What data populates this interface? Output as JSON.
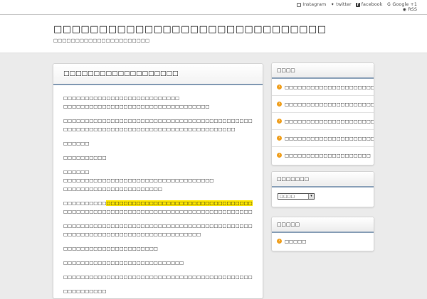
{
  "sns": {
    "instagram": "Instagram",
    "twitter": "twitter",
    "facebook": "facebook",
    "google": "Google +1",
    "rss": "RSS"
  },
  "header": {
    "title": "□□□□□□□□□□□□□□□□□□□□□□□□□□□□□□",
    "description": "□□□□□□□□□□□□□□□□□□□□□□"
  },
  "post": {
    "title": "□□□□□□□□□□□□□□□□□□□",
    "paragraphs": [
      [
        "□□□□□□□□□□□□□□□□□□□□□□□□□□□",
        "□□□□□□□□□□□□□□□□□□□□□□□□□□□□□□□□□□"
      ],
      [
        "□□□□□□□□□□□□□□□□□□□□□□□□□□□□□□□□□□□□□□□□□□□□□□□□□□□□□□□□□□□□□",
        "□□□□□□□□□□□□□□□□□□□□□□□□□□□□□□□□□□□□□□□□"
      ],
      [
        "□□□□□□"
      ],
      [
        "□□□□□□□□□□"
      ],
      [
        "□□□□□□",
        "□□□□□□□□□□□□□□□□□□□□□□□□□□□□□□□□□□□",
        "□□□□□□□□□□□□□□□□□□□□□□□"
      ]
    ],
    "highlight_line": {
      "pre": "□□□□□□□□□□",
      "mark": "□□□□□□□□□□□□□□□□□□□□□□□□□□□□□□□□□□□□□□□",
      "post": "□□□□□"
    },
    "highlight_line2": "□□□□□□□□□□□□□□□□□□□□□□□□□□□□□□□□□□□□□□□□□□□□□□□□□□□",
    "paragraphs_after": [
      [
        "□□□□□□□□□□□□□□□□□□□□□□□□□□□□□□□□□□□□□□□□□□□□□□□□□□□□□□□□□□□□□",
        "□□□□□□□□□□□□□□□□□□□□□□□□□□□□□□□□"
      ],
      [
        "□□□□□□□□□□□□□□□□□□□□□□"
      ],
      [
        "□□□□□□□□□□□□□□□□□□□□□□□□□□□□"
      ],
      [
        "□□□□□□□□□□□□□□□□□□□□□□□□□□□□□□□□□□□□□□□□□□□□□□□□□□□□□□□"
      ],
      [
        "□□□□□□□□□□"
      ]
    ]
  },
  "sidebar": {
    "recent": {
      "title": "□□□□",
      "items": [
        "□□□□□□□□□□□□□□□□□□□□□□□□",
        "□□□□□□□□□□□□□□□□□□□□□□□□□□",
        "□□□□□□□□□□□□□□□□□□□□□□□□□□",
        "□□□□□□□□□□□□□□□□□□□□□",
        "□□□□□□□□□□□□□□□□□□□□"
      ]
    },
    "archive": {
      "title": "□□□□□□□",
      "select_value": "□□□□"
    },
    "category": {
      "title": "□□□□□",
      "items": [
        "□□□□□"
      ]
    }
  },
  "colors": {
    "accent_border": "#8aa0b8",
    "arrow": "#f0a020",
    "highlight": "#ffe800"
  }
}
